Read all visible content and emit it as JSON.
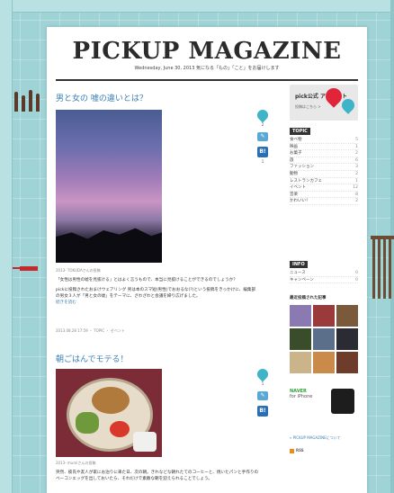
{
  "header": {
    "title": "PICKUP MAGAZINE",
    "subtitle": "Wednesday, June 30, 2013    気になる「もの」「こと」をお届けします"
  },
  "posts": [
    {
      "title": "男と女の 嘘の違いとは？",
      "author": "2013-  TOKUDAさんの投稿",
      "body": "「女性は男性の嘘を見抜ける」とはよく言うもので、本当に見抜けることができるのでしょうか？",
      "body2": "pickに投稿されたおまけウェアリング 男は本のスマ短(男性)でおおるな(?)という投稿をきっかけに、編集部の男女３人が「男と女の嘘」をテーマに、ざわざわと会議を繰り広げました。",
      "more": "続きを読む",
      "footer": "2013.08.28 17:59 ・ TOPIC ・ ゼベント",
      "share": {
        "pin_count": "2",
        "hb_count": "1"
      }
    },
    {
      "title": "朝ごはんでモテる！",
      "author": "2013-  mumiさんの投稿",
      "body": "突然、彼氏や友人が家にお泊りに来た日、次の朝。きれなどな朝れたてのコーヒーと、焼いたパンと手作りのベーコンエッグを出しておいたら、それだけで素敵な朝を迎えられることでしょう。",
      "share": {
        "pin_count": "1",
        "hb_count": ""
      }
    }
  ],
  "sidebar": {
    "banner": {
      "title": "pick公式 アカウント",
      "sub": "投稿はこちら >"
    },
    "topic_head": "TOPIC",
    "topics": [
      {
        "label": "食べ物",
        "count": "5"
      },
      {
        "label": "映画",
        "count": "1"
      },
      {
        "label": "お菓子",
        "count": "2"
      },
      {
        "label": "旅",
        "count": "6"
      },
      {
        "label": "ファッション",
        "count": "3"
      },
      {
        "label": "動物",
        "count": "2"
      },
      {
        "label": "レストランカフェ",
        "count": "1"
      },
      {
        "label": "イベント",
        "count": "12"
      },
      {
        "label": "音楽",
        "count": "8"
      },
      {
        "label": "かわいい！",
        "count": "2"
      }
    ],
    "info_head": "INFO",
    "info": [
      {
        "label": "ニュース",
        "count": "0"
      },
      {
        "label": "キャンペーン",
        "count": "0"
      }
    ],
    "recent_head": "最近投稿された記事",
    "naver": {
      "title": "NAVER",
      "sub": "for iPhone"
    },
    "about_link": "» PICKUP MAGAZINEについて",
    "rss": "RSS"
  },
  "colors": {
    "background": "#9fd3d6",
    "link": "#3b7fb5",
    "accent_pin": "#3fb3c8",
    "hatena": "#2a6fb6"
  }
}
